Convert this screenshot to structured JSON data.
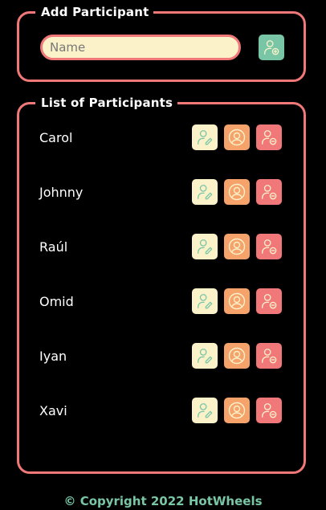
{
  "add_section": {
    "legend": "Add Participant",
    "name_placeholder": "Name",
    "name_value": "",
    "add_button_icon": "user-add-icon"
  },
  "list_section": {
    "legend": "List of Participants",
    "participants": [
      {
        "name": "Carol"
      },
      {
        "name": "Johnny"
      },
      {
        "name": "Raúl"
      },
      {
        "name": "Omid"
      },
      {
        "name": "Iyan"
      },
      {
        "name": "Xavi"
      }
    ],
    "row_icons": {
      "edit": "user-edit-icon",
      "profile": "user-circle-icon",
      "remove": "user-remove-icon"
    }
  },
  "footer": {
    "text": "© Copyright 2022 HotWheels"
  },
  "colors": {
    "background": "#000000",
    "border": "#f07878",
    "input_background": "#fbf2c9",
    "green": "#79c6a6",
    "orange": "#f6a26b",
    "red": "#f07878"
  }
}
